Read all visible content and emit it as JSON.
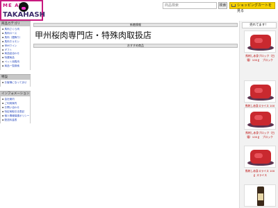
{
  "logo": {
    "top_text": "ME AT",
    "bottom_text": "TAKAHASH"
  },
  "header": {
    "search_placeholder": "商品検索",
    "search_button": "検索",
    "cart_button": "ショッピングカートを見る"
  },
  "sidebar": {
    "categories_title": "商品カテゴリ",
    "categories": [
      "馬肉さくら肉",
      "馬肉ロース",
      "馬肉（霜降り）",
      "馬肉ホルモン",
      "甲州ワイン",
      "ギフト",
      "商品詰合わせ",
      "特選商品",
      "ペット用馬肉",
      "商品一覧検索"
    ],
    "notice_title": "特設",
    "notices": [
      "お客様になってませ"
    ],
    "info_title": "インフォメーション",
    "info": [
      "会社案内",
      "ご利用案内",
      "お問い合わせ",
      "特定商取引法表記",
      "個人情報保護ポリシー",
      "配送料金表"
    ]
  },
  "main": {
    "news_bar": "新着情報",
    "headline": "甲州桜肉専門店・特殊肉取扱店",
    "recommend_bar": "おすすめ商品"
  },
  "right": {
    "title": "売れてます！",
    "products": [
      "馬刺し赤身ブロック（白霜）100ｇ　ブロック",
      "馬刺し赤身スライス 100ｇ スライス",
      "馬刺し赤身ブロック（白霜）100ｇ　ブロック",
      "馬刺し赤身スライス 100ｇ スライス"
    ]
  }
}
